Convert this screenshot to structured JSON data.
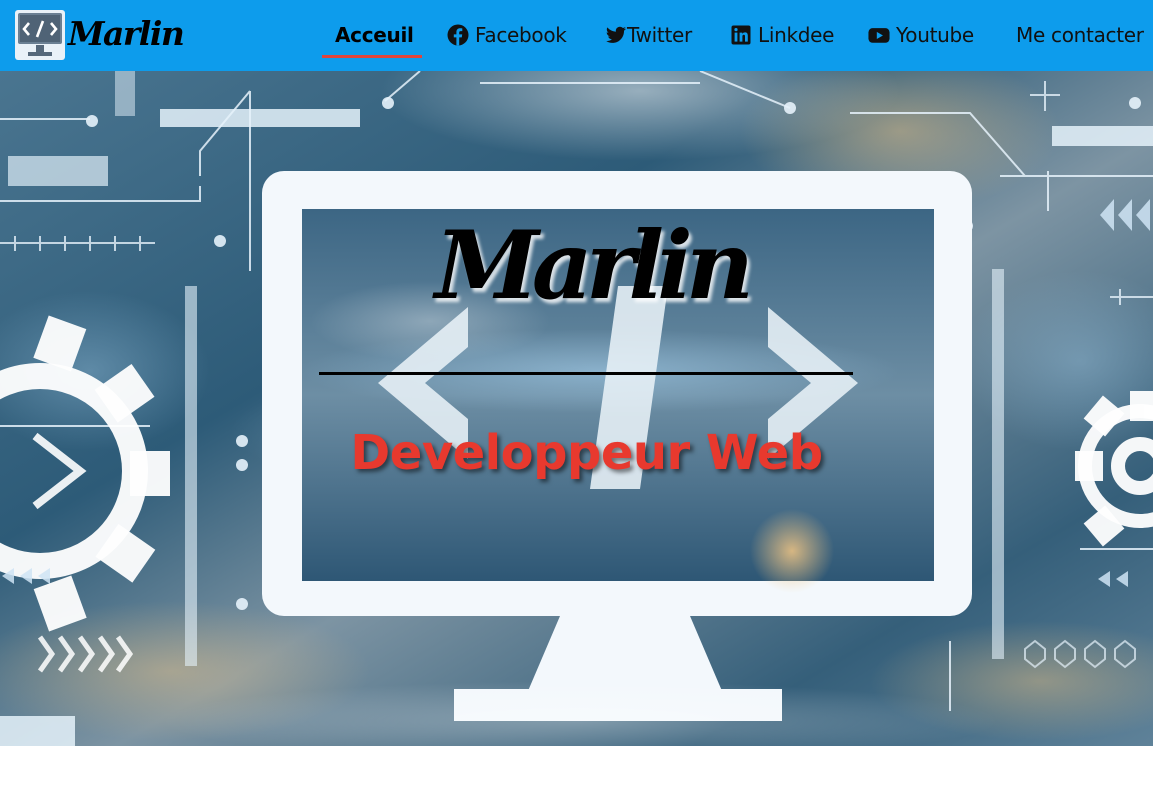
{
  "brand": {
    "name": "Marlin",
    "logo_icon": "code-monitor-icon"
  },
  "nav": {
    "items": [
      {
        "label": "Acceuil",
        "icon": null,
        "active": true
      },
      {
        "label": "Facebook",
        "icon": "facebook-icon"
      },
      {
        "label": "Twitter",
        "icon": "twitter-icon"
      },
      {
        "label": "Linkdee",
        "icon": "linkedin-icon"
      },
      {
        "label": "Youtube",
        "icon": "youtube-icon"
      },
      {
        "label": "Me contacter",
        "icon": null
      }
    ]
  },
  "hero": {
    "title": "Marlin",
    "subtitle": "Developpeur Web"
  },
  "colors": {
    "navbar": "#0d9cec",
    "active_underline": "#e0453b",
    "subtitle": "#e8392e"
  }
}
